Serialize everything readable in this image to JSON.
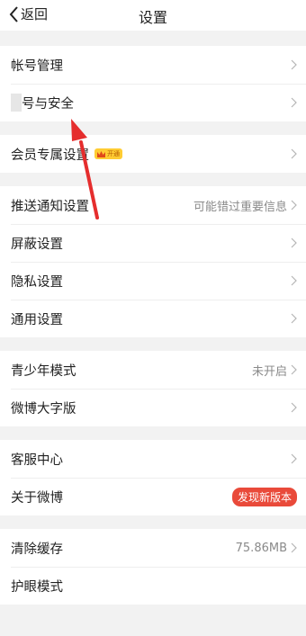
{
  "header": {
    "back_label": "返回",
    "title": "设置"
  },
  "sections": {
    "account": {
      "manage": "帐号管理",
      "security": "号与安全"
    },
    "vip": {
      "label": "会员专属设置",
      "badge": "开通"
    },
    "notify": {
      "push": "推送通知设置",
      "push_value": "可能错过重要信息",
      "block": "屏蔽设置",
      "privacy": "隐私设置",
      "general": "通用设置"
    },
    "youth": {
      "mode": "青少年模式",
      "mode_value": "未开启",
      "big_font": "微博大字版"
    },
    "about": {
      "service": "客服中心",
      "about": "关于微博",
      "new_version": "发现新版本"
    },
    "cache": {
      "clear": "清除缓存",
      "size": "75.86MB",
      "eye": "护眼模式"
    }
  },
  "colors": {
    "accent_red": "#e94a3a",
    "badge_yellow": "#ffcc33",
    "arrow_red": "#e52d2d"
  }
}
